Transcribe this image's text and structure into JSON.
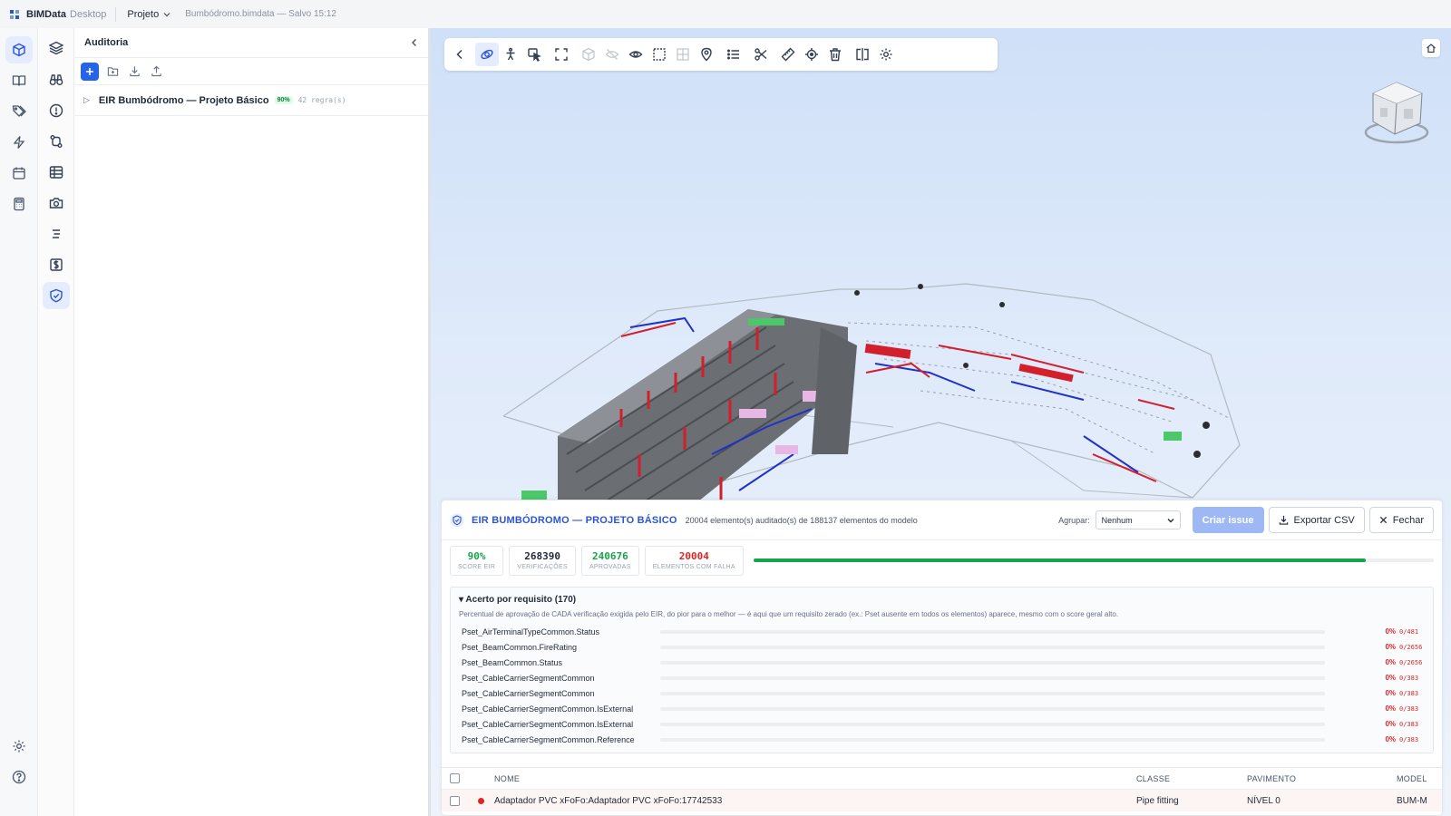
{
  "topbar": {
    "app_name": "BIMData",
    "app_name_suffix": "Desktop",
    "project_menu": "Projeto",
    "file_status": "Bumbódromo.bimdata — Salvo 15:12"
  },
  "rail": {
    "items": [
      "cube-icon",
      "book-icon",
      "tags-icon",
      "bolt-icon",
      "calendar-icon",
      "calculator-icon"
    ],
    "bottom": [
      "gear-icon",
      "help-icon"
    ]
  },
  "rail2": {
    "items": [
      "layers-icon",
      "binoculars-icon",
      "alert-icon",
      "git-compare-icon",
      "table-icon",
      "camera-icon",
      "list-icon",
      "dollar-icon",
      "shield-check-icon"
    ]
  },
  "panel": {
    "title": "Auditoria",
    "tree": [
      {
        "label": "EIR Bumbódromo — Projeto Básico",
        "badge": "90%",
        "count": "42 regra(s)"
      }
    ]
  },
  "viewer": {
    "toolbar_icons": [
      "back-icon",
      "orbit-icon",
      "walk-icon",
      "select-icon",
      "fit-view-icon",
      "cube-icon",
      "hide-icon",
      "eye-icon",
      "box-select-icon",
      "grid-icon",
      "pin-icon",
      "list-icon",
      "scissors-icon",
      "ruler-icon",
      "crosshair-icon",
      "trash-icon",
      "split-icon",
      "settings-icon"
    ],
    "active_tool": "orbit-icon"
  },
  "audit": {
    "title": "EIR BUMBÓDROMO — PROJETO BÁSICO",
    "subtitle": "20004 elemento(s) auditado(s) de 188137 elementos do modelo",
    "group_label": "Agrupar:",
    "group_value": "Nenhum",
    "btn_issue": "Criar issue",
    "btn_export": "Exportar CSV",
    "btn_close": "Fechar",
    "stats": [
      {
        "value": "90%",
        "label": "SCORE EIR",
        "color": "#16a34a"
      },
      {
        "value": "268390",
        "label": "VERIFICAÇÕES",
        "color": "#1f2937"
      },
      {
        "value": "240676",
        "label": "APROVADAS",
        "color": "#16a34a"
      },
      {
        "value": "20004",
        "label": "ELEMENTOS COM FALHA",
        "color": "#dc2626"
      }
    ],
    "score_fraction": 0.9,
    "req_header": "▾ Acerto por requisito (170)",
    "req_desc": "Percentual de aprovação de CADA verificação exigida pelo EIR, do pior para o melhor — é aqui que um requisito zerado (ex.: Pset ausente em todos os elementos) aparece, mesmo com o score geral alto.",
    "requirements": [
      {
        "name": "Pset_AirTerminalTypeCommon.Status",
        "pct": "0%",
        "frac": "0/481"
      },
      {
        "name": "Pset_BeamCommon.FireRating",
        "pct": "0%",
        "frac": "0/2656"
      },
      {
        "name": "Pset_BeamCommon.Status",
        "pct": "0%",
        "frac": "0/2656"
      },
      {
        "name": "Pset_CableCarrierSegmentCommon",
        "pct": "0%",
        "frac": "0/383"
      },
      {
        "name": "Pset_CableCarrierSegmentCommon",
        "pct": "0%",
        "frac": "0/383"
      },
      {
        "name": "Pset_CableCarrierSegmentCommon.IsExternal",
        "pct": "0%",
        "frac": "0/383"
      },
      {
        "name": "Pset_CableCarrierSegmentCommon.IsExternal",
        "pct": "0%",
        "frac": "0/383"
      },
      {
        "name": "Pset_CableCarrierSegmentCommon.Reference",
        "pct": "0%",
        "frac": "0/383"
      }
    ],
    "table": {
      "headers": {
        "name": "NOME",
        "classe": "CLASSE",
        "pavimento": "PAVIMENTO",
        "model": "MODEL"
      },
      "rows": [
        {
          "name": "Adaptador PVC xFoFo:Adaptador PVC xFoFo:17742533",
          "classe": "Pipe fitting",
          "pavimento": "NÍVEL 0",
          "model": "BUM-M"
        }
      ]
    }
  }
}
